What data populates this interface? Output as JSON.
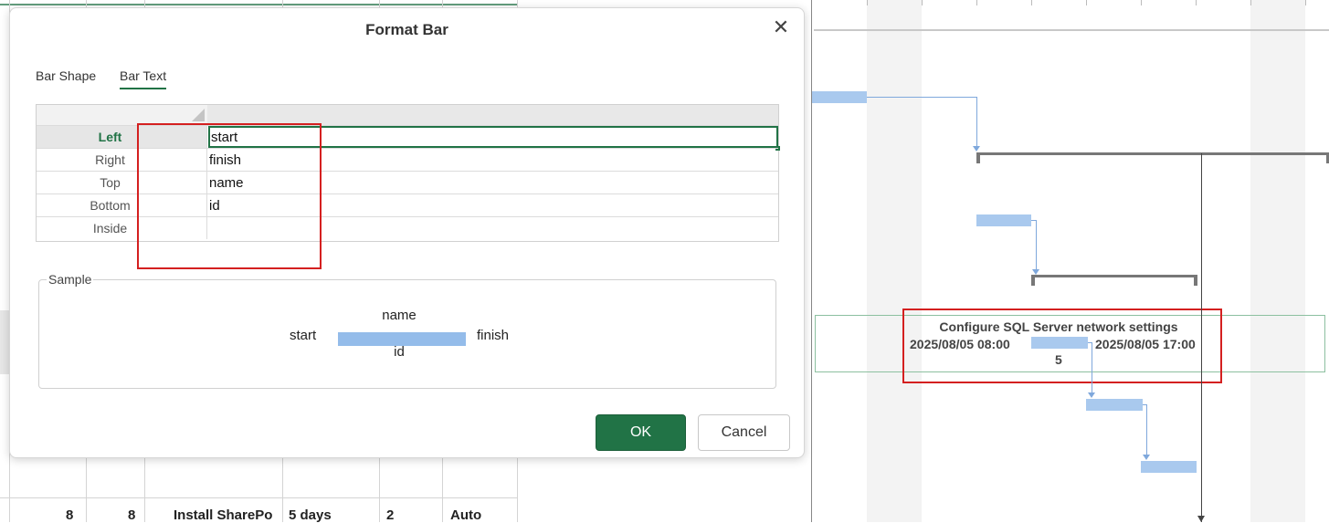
{
  "dialog": {
    "title": "Format Bar",
    "tabs": [
      {
        "label": "Bar Shape",
        "active": false
      },
      {
        "label": "Bar Text",
        "active": true
      }
    ],
    "rows": [
      {
        "label": "Left",
        "value": "start"
      },
      {
        "label": "Right",
        "value": "finish"
      },
      {
        "label": "Top",
        "value": "name"
      },
      {
        "label": "Bottom",
        "value": "id"
      },
      {
        "label": "Inside",
        "value": ""
      }
    ],
    "sample": {
      "legend": "Sample",
      "top": "name",
      "left": "start",
      "right": "finish",
      "bottom": "id"
    },
    "ok_label": "OK",
    "cancel_label": "Cancel"
  },
  "sheet": {
    "row": {
      "col1": "8",
      "col2": "8",
      "name": "Install SharePo",
      "duration": "5 days",
      "pred": "2",
      "mode": "Auto"
    }
  },
  "gantt": {
    "selected_task": {
      "name": "Configure SQL Server network settings",
      "start": "2025/08/05 08:00",
      "finish": "2025/08/05 17:00",
      "id": "5"
    }
  },
  "colors": {
    "accent": "#217346",
    "bar": "#a9c9ee",
    "highlight": "#d42020"
  }
}
